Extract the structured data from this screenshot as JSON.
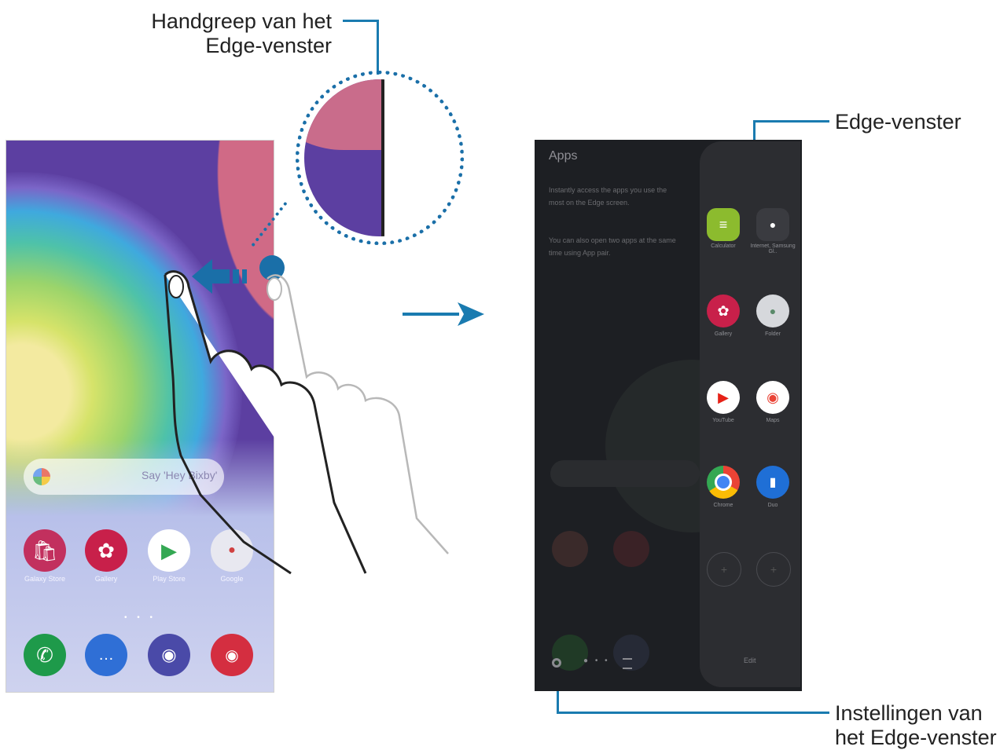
{
  "callouts": {
    "handle": {
      "line1": "Handgreep van het",
      "line2": "Edge-venster"
    },
    "panel": "Edge-venster",
    "settings": {
      "line1": "Instellingen van",
      "line2": "het Edge-venster"
    }
  },
  "colors": {
    "accent": "#1a7bb0",
    "wallpaper_purple": "#5c3fa1",
    "panel_bg": "#2c2d31"
  },
  "left_phone": {
    "search_placeholder": "Say 'Hey Bixby'",
    "apps_row1": [
      {
        "icon": "galaxy-store-icon",
        "label": "Galaxy Store",
        "color": "#c2305e"
      },
      {
        "icon": "gallery-icon",
        "label": "Gallery",
        "color": "#c8204a"
      },
      {
        "icon": "play-store-icon",
        "label": "Play Store",
        "color": "#ffffff"
      },
      {
        "icon": "google-folder-icon",
        "label": "Google",
        "color": "#e8e8f0"
      }
    ],
    "dock": [
      {
        "icon": "phone-icon",
        "color": "#1e9a4a"
      },
      {
        "icon": "messages-icon",
        "color": "#2f6fd6"
      },
      {
        "icon": "internet-icon",
        "color": "#4a4aa8"
      },
      {
        "icon": "camera-icon",
        "color": "#d42e40"
      }
    ]
  },
  "right_phone": {
    "title": "Apps",
    "desc1": "Instantly access the apps you use the most on the Edge screen.",
    "desc2": "You can also open two apps at the same time using App pair.",
    "edge_apps": [
      {
        "icon": "calculator-icon",
        "label": "Calculator",
        "color": "#8cbb2e"
      },
      {
        "icon": "samsung-folder-icon",
        "label": "Internet, Samsung Gl..",
        "color": "#3a3b40"
      },
      {
        "icon": "gallery-icon",
        "label": "Gallery",
        "color": "#c8204a"
      },
      {
        "icon": "folder-icon",
        "label": "Folder",
        "color": "#d6d8dc"
      },
      {
        "icon": "youtube-icon",
        "label": "YouTube",
        "color": "#ffffff"
      },
      {
        "icon": "maps-icon",
        "label": "Maps",
        "color": "#ffffff"
      },
      {
        "icon": "chrome-icon",
        "label": "Chrome",
        "color": "#ffffff"
      },
      {
        "icon": "duo-icon",
        "label": "Duo",
        "color": "#1f6fd6"
      }
    ],
    "edit_label": "Edit"
  }
}
